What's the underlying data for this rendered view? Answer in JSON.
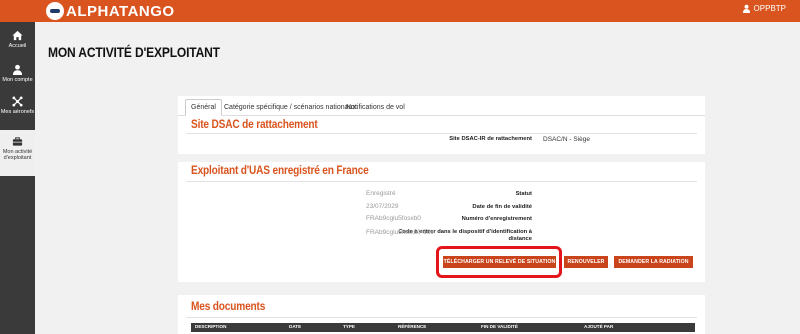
{
  "app": {
    "brand": "ALPHATANGO",
    "user": "OPPBTP"
  },
  "sidebar": {
    "items": [
      {
        "label": "Accueil",
        "icon": "home-icon"
      },
      {
        "label": "Mon compte",
        "icon": "user-icon"
      },
      {
        "label": "Mes aéronefs",
        "icon": "drone-icon"
      },
      {
        "label": "Mon activité d'exploitant",
        "icon": "briefcase-icon"
      }
    ]
  },
  "page": {
    "title": "MON ACTIVITÉ D'EXPLOITANT"
  },
  "tabs": [
    "Général",
    "Catégorie spécifique / scénarios nationaux",
    "Notifications de vol"
  ],
  "dsac": {
    "title": "Site DSAC de rattachement",
    "label": "Site DSAC-IR de rattachement",
    "value": "DSAC/N - Siège"
  },
  "exploitant": {
    "title": "Exploitant d'UAS enregistré en France",
    "fields": [
      {
        "label": "Statut",
        "value": "Enregistré"
      },
      {
        "label": "Date de fin de validité",
        "value": "23/07/2029"
      },
      {
        "label": "Numéro d'enregistrement",
        "value": "FRAb9cglu5fosxb0"
      },
      {
        "label": "Code à entrer dans le dispositif d'identification à distance",
        "value": "FRAb9cglu5fosxb0-36c"
      }
    ],
    "buttons": {
      "download": "TÉLÉCHARGER UN RELEVÉ DE SITUATION",
      "renew": "RENOUVELER",
      "radiation": "DEMANDER LA RADIATION"
    }
  },
  "documents": {
    "title": "Mes documents",
    "columns": [
      "DESCRIPTION",
      "DATE",
      "TYPE",
      "RÉFÉRENCE",
      "FIN DE VALIDITÉ",
      "AJOUTÉ PAR"
    ]
  },
  "colors": {
    "brand": "#d9541e",
    "button": "#c9441a",
    "highlight": "#e3141a",
    "sidebar": "#3a3a3a"
  }
}
